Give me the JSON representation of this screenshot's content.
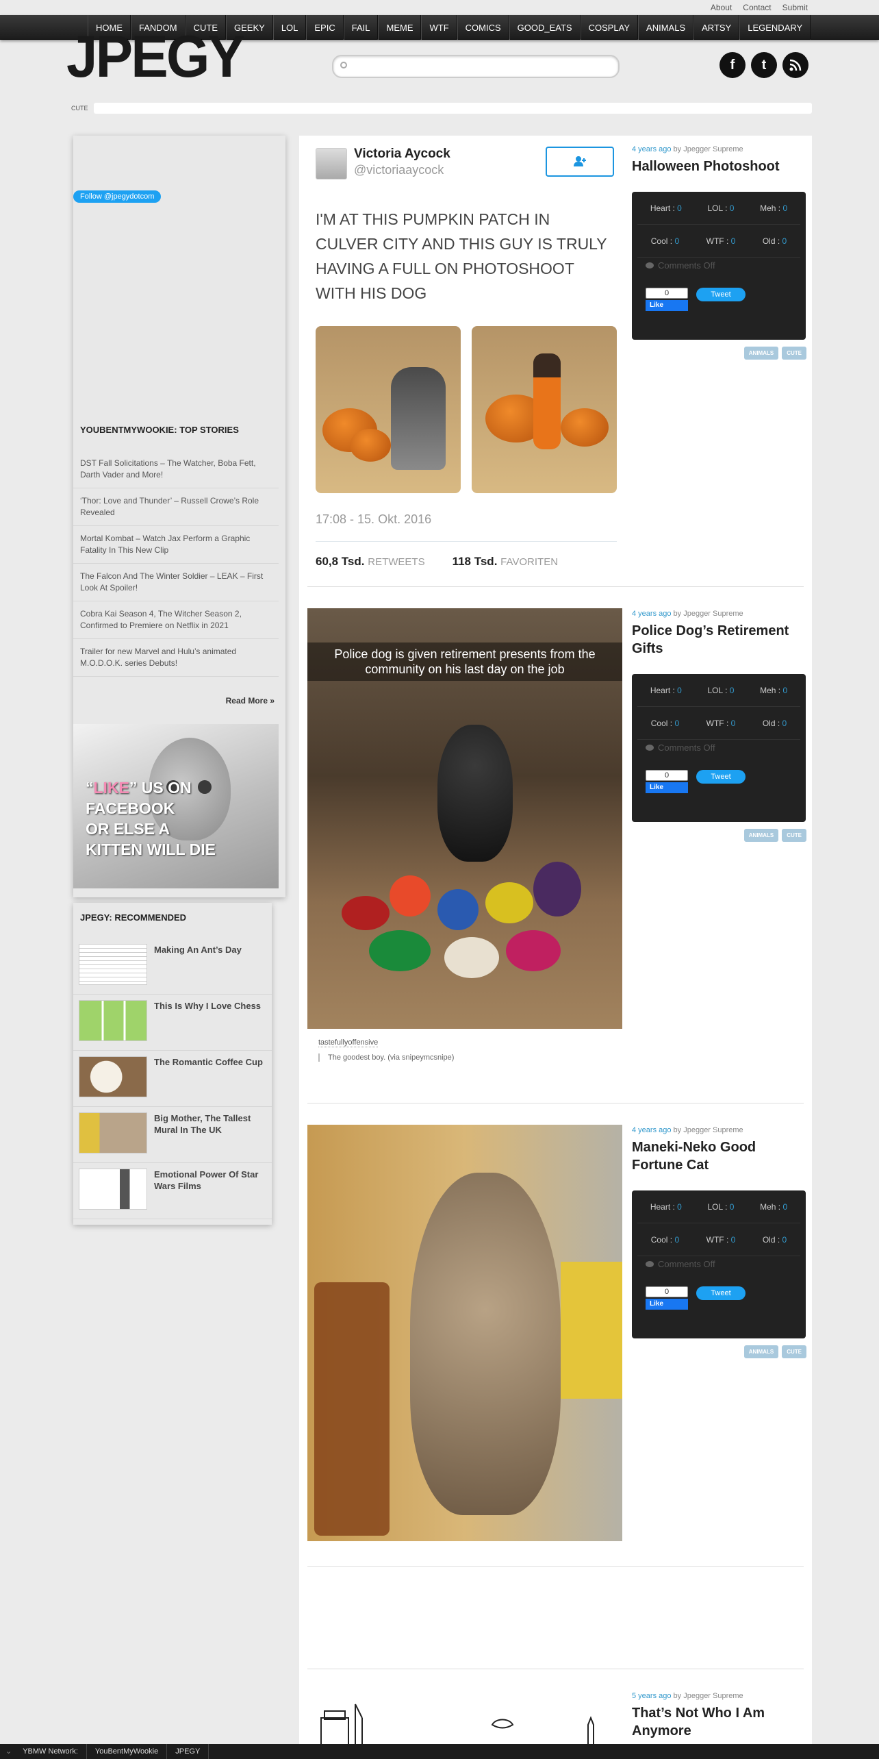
{
  "top_links": [
    "About",
    "Contact",
    "Submit"
  ],
  "nav": [
    "HOME",
    "FANDOM",
    "CUTE",
    "GEEKY",
    "LOL",
    "EPIC",
    "FAIL",
    "MEME",
    "WTF",
    "COMICS",
    "GOOD_EATS",
    "COSPLAY",
    "ANIMALS",
    "ARTSY",
    "LEGENDARY"
  ],
  "logo": "JPEGY",
  "search": {
    "placeholder": ""
  },
  "breadcrumb": "CUTE",
  "sidebar": {
    "twitter_follow": "Follow @jpegydotcom",
    "top_stories_title": "YOUBENTMYWOOKIE: TOP STORIES",
    "stories": [
      "DST Fall Solicitations – The Watcher, Boba Fett, Darth Vader and More!",
      "‘Thor: Love and Thunder’ – Russell Crowe’s Role Revealed",
      "Mortal Kombat – Watch Jax Perform a Graphic Fatality In This New Clip",
      "The Falcon And The Winter Soldier – LEAK – First Look At Spoiler!",
      "Cobra Kai Season 4, The Witcher Season 2, Confirmed to Premiere on Netflix in 2021",
      "Trailer for new Marvel and Hulu’s animated M.O.D.O.K. series Debuts!"
    ],
    "read_more": "Read More »",
    "kitten_ad": {
      "q_open": "“",
      "like": "LIKE",
      "q_close": "”",
      "line1": " US ON",
      "line2": "FACEBOOK",
      "line3": "OR ELSE A",
      "line4": "KITTEN WILL DIE"
    },
    "recommended_title": "JPEGY: RECOMMENDED",
    "recommended": [
      "Making An Ant’s Day",
      "This Is Why I Love Chess",
      "The Romantic Coffee Cup",
      "Big Mother, The Tallest Mural In The UK",
      "Emotional Power Of Star Wars Films"
    ]
  },
  "posts": [
    {
      "ago": "4 years ago",
      "by": "by Jpegger Supreme",
      "title": "Halloween Photoshoot",
      "tweet": {
        "name": "Victoria Aycock",
        "handle": "@victoriaaycock",
        "text": "I'M AT THIS PUMPKIN PATCH IN CULVER CITY AND THIS GUY IS TRULY HAVING A FULL ON PHOTOSHOOT WITH HIS DOG",
        "time": "17:08 - 15. Okt. 2016",
        "retweets_num": "60,8 Tsd.",
        "retweets_label": "RETWEETS",
        "favs_num": "118 Tsd.",
        "favs_label": "FAVORITEN"
      },
      "tags": [
        "ANIMALS",
        "CUTE"
      ]
    },
    {
      "ago": "4 years ago",
      "by": "by Jpegger Supreme",
      "title": "Police Dog’s Retirement Gifts",
      "caption": "Police dog is given retirement presents from the community on his last day on the job",
      "source": "tastefullyoffensive",
      "quote": "The goodest boy. (via snipeymcsnipe)",
      "tags": [
        "ANIMALS",
        "CUTE"
      ]
    },
    {
      "ago": "4 years ago",
      "by": "by Jpegger Supreme",
      "title": "Maneki-Neko Good Fortune Cat",
      "tags": [
        "ANIMALS",
        "CUTE"
      ]
    },
    {
      "ago": "5 years ago",
      "by": "by Jpegger Supreme",
      "title": "That’s Not Who I Am Anymore"
    }
  ],
  "votes": {
    "heart": "Heart",
    "lol": "LOL",
    "meh": "Meh",
    "cool": "Cool",
    "wtf": "WTF",
    "old": "Old",
    "count": "0",
    "comments": "Comments Off",
    "fb_count": "0",
    "fb_like": "Like",
    "tweet": "Tweet"
  },
  "network": {
    "label": "YBMW Network:",
    "links": [
      "YouBentMyWookie",
      "JPEGY"
    ]
  },
  "colors": {
    "accent": "#3399cc",
    "nav_bg": "#222222",
    "tag_bg": "#a9c9dd",
    "twitter": "#1da1f2",
    "facebook": "#1877f2"
  }
}
